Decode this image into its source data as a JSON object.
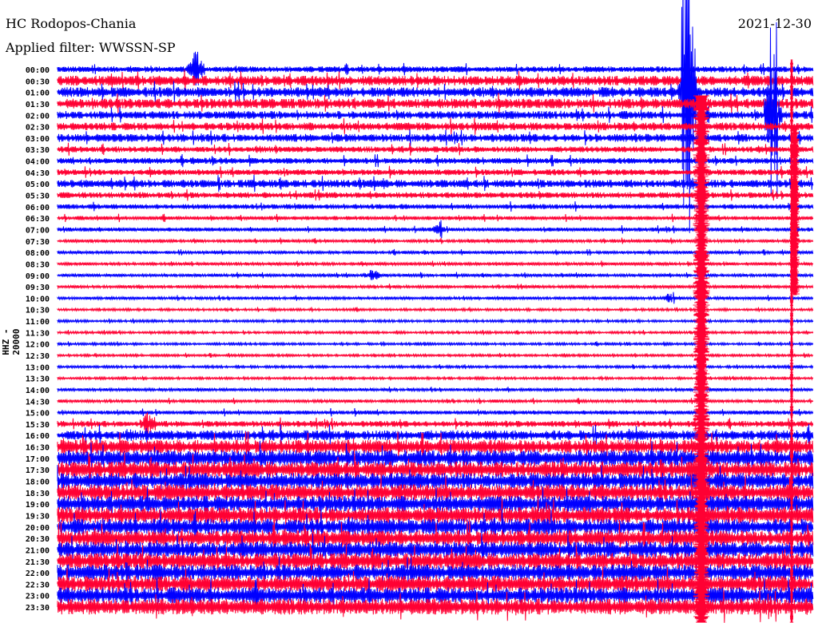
{
  "header": {
    "station": "HC Rodopos-Chania",
    "filter": "Applied filter: WWSSN-SP",
    "date": "2021-12-30"
  },
  "chart_data": {
    "type": "line",
    "title": "HC Rodopos-Chania",
    "ylabel": "HHZ - 20000",
    "xlabel": "",
    "colors": [
      "#0000ff",
      "#ff0033"
    ],
    "row_labels": [
      "00:00",
      "00:30",
      "01:00",
      "01:30",
      "02:00",
      "02:30",
      "03:00",
      "03:30",
      "04:00",
      "04:30",
      "05:00",
      "05:30",
      "06:00",
      "06:30",
      "07:00",
      "07:30",
      "08:00",
      "08:30",
      "09:00",
      "09:30",
      "10:00",
      "10:30",
      "11:00",
      "11:30",
      "12:00",
      "12:30",
      "13:00",
      "13:30",
      "14:00",
      "14:30",
      "15:00",
      "15:30",
      "16:00",
      "16:30",
      "17:00",
      "17:30",
      "18:00",
      "18:30",
      "19:00",
      "19:30",
      "20:00",
      "20:30",
      "21:00",
      "21:30",
      "22:00",
      "22:30",
      "23:00",
      "23:30"
    ],
    "noise_level": [
      3,
      5,
      5,
      5,
      4,
      4,
      4,
      3,
      3,
      3,
      4,
      3,
      2.5,
      2,
      2,
      1.5,
      1.5,
      1.5,
      1.5,
      1.5,
      1.5,
      1.2,
      1.2,
      1.2,
      1.2,
      1.2,
      1.2,
      1.2,
      1.5,
      1.5,
      2,
      3,
      5,
      7,
      8,
      8,
      8,
      8,
      8,
      8,
      8,
      8,
      8,
      8,
      8,
      8,
      8,
      8
    ],
    "events": [
      {
        "row": 0,
        "minute": 5.5,
        "amplitude": 25
      },
      {
        "row": 14,
        "minute": 15.2,
        "amplitude": 10
      },
      {
        "row": 18,
        "minute": 12.5,
        "amplitude": 10
      },
      {
        "row": 20,
        "minute": 24.4,
        "amplitude": 8
      },
      {
        "row": 31,
        "minute": 3.6,
        "amplitude": 15
      },
      {
        "row": 2,
        "minute": 25.0,
        "amplitude": 300
      },
      {
        "row": 4,
        "minute": 28.4,
        "amplitude": 200
      }
    ]
  }
}
